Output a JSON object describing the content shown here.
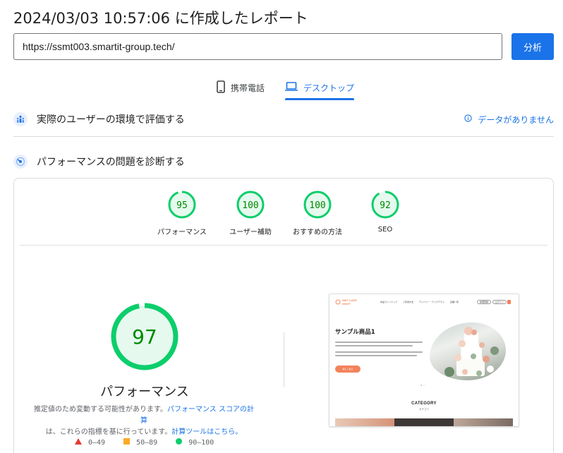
{
  "header": {
    "report_title": "2024/03/03 10:57:06 に作成したレポート",
    "url_value": "https://ssmt003.smartit-group.tech/",
    "analyze_label": "分析"
  },
  "device_tabs": [
    {
      "label": "携帯電話",
      "icon": "phone-icon",
      "selected": false
    },
    {
      "label": "デスクトップ",
      "icon": "laptop-icon",
      "selected": true
    }
  ],
  "field_data": {
    "title": "実際のユーザーの環境で評価する",
    "no_data_label": "データがありません"
  },
  "diagnose": {
    "title": "パフォーマンスの問題を診断する"
  },
  "scores": [
    {
      "label": "パフォーマンス",
      "value": "95"
    },
    {
      "label": "ユーザー補助",
      "value": "100"
    },
    {
      "label": "おすすめの方法",
      "value": "100"
    },
    {
      "label": "SEO",
      "value": "92"
    }
  ],
  "performance": {
    "score": "97",
    "title": "パフォーマンス",
    "desc_pre": "推定値のため変動する可能性があります。",
    "desc_link1": "パフォーマンス スコアの計算",
    "desc_mid": "は、これらの指標を基に行っています。",
    "desc_link2": "計算ツールはこちら。"
  },
  "legend": [
    {
      "range": "0–49",
      "shape": "triangle",
      "color": "#e53935"
    },
    {
      "range": "50–89",
      "shape": "square",
      "color": "#fbab25"
    },
    {
      "range": "90–100",
      "shape": "circle",
      "color": "#0cce6b"
    }
  ],
  "thumbnail": {
    "logo_line1": "SMT CAKE",
    "logo_line2": "SHOP",
    "nav": [
      "商品ラインナップ",
      "ご利用方法",
      "デリバリー・テイクアウト",
      "店舗一覧"
    ],
    "btn1": "新規登録",
    "btn2": "ログイン",
    "hero_title": "サンプル商品1",
    "cta": "詳しく見る",
    "category": "CATEGORY",
    "category_sub": "カテゴリ"
  },
  "colors": {
    "accent": "#1a73e8",
    "pass": "#0cce6b",
    "pass_fill": "#e6f9ee",
    "pass_text": "#008800"
  }
}
